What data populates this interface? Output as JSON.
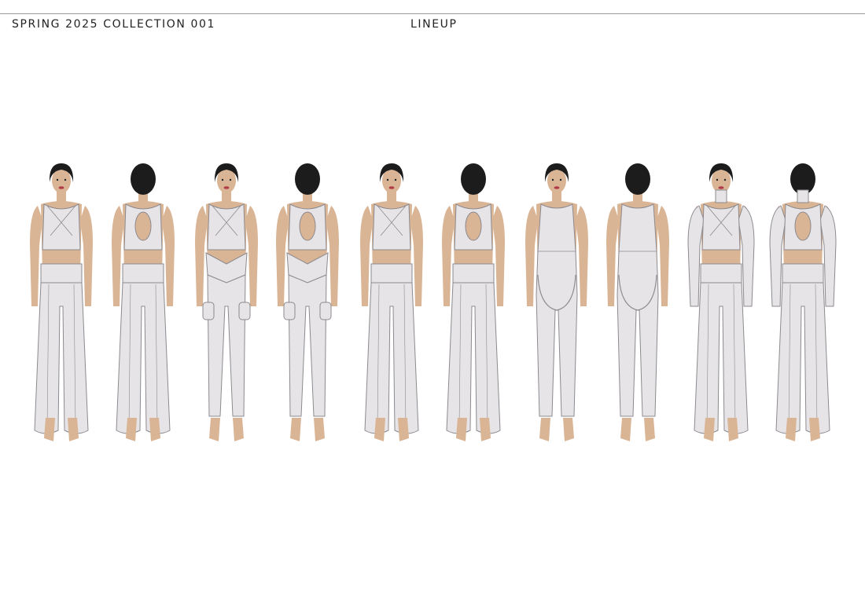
{
  "header": {
    "collection_title": "SPRING 2025 COLLECTION 001",
    "section_label": "LINEUP"
  },
  "colors": {
    "garment": "#e6e4e6",
    "stroke": "#8d8a8f",
    "skin": "#d9b596",
    "hair": "#1c1c1c"
  },
  "figures": [
    {
      "view": "front",
      "top": "criss-cross halter crop",
      "bottom": "wide-leg trouser"
    },
    {
      "view": "back",
      "top": "criss-cross halter crop",
      "bottom": "wide-leg trouser"
    },
    {
      "view": "front",
      "top": "cowl neck crop",
      "bottom": "wrap-waist legging with knee pads"
    },
    {
      "view": "back",
      "top": "cutout crop",
      "bottom": "wrap-waist legging with knee pads"
    },
    {
      "view": "front",
      "top": "asymmetric halter crop",
      "bottom": "wide-leg pleated trouser"
    },
    {
      "view": "back",
      "top": "keyhole back crop",
      "bottom": "wide-leg pleated trouser"
    },
    {
      "view": "front",
      "top": "scoop neck catsuit",
      "bottom": "curved seam legging"
    },
    {
      "view": "back",
      "top": "scoop back catsuit",
      "bottom": "curved seam legging"
    },
    {
      "view": "front",
      "top": "long-sleeve mock neck crop",
      "bottom": "wide-leg trouser"
    },
    {
      "view": "back",
      "top": "long-sleeve keyhole crop",
      "bottom": "wide-leg trouser"
    }
  ]
}
